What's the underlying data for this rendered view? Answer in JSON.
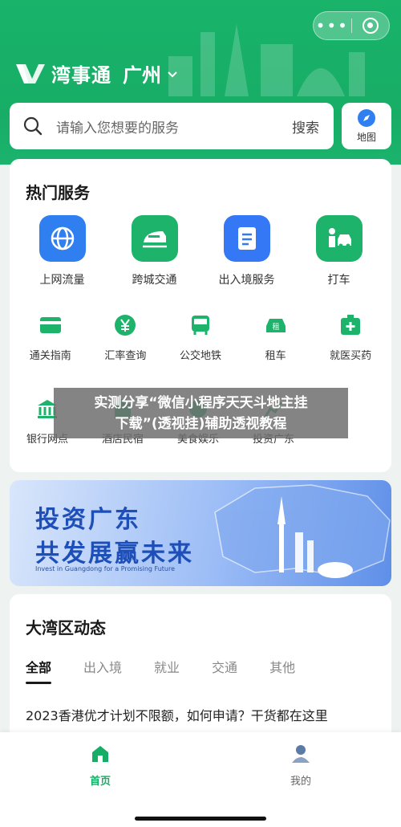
{
  "header": {
    "brand": "湾事通",
    "city": "广州",
    "capsule_menu_icon": "more-dots-icon",
    "capsule_close_icon": "target-icon"
  },
  "search": {
    "placeholder": "请输入您想要的服务",
    "button": "搜索",
    "map_label": "地图"
  },
  "hot_services": {
    "title": "热门服务",
    "primary": [
      {
        "label": "上网流量",
        "icon": "globe-icon"
      },
      {
        "label": "跨城交通",
        "icon": "train-icon"
      },
      {
        "label": "出入境服务",
        "icon": "document-plane-icon"
      },
      {
        "label": "打车",
        "icon": "taxi-icon"
      }
    ],
    "secondary": [
      {
        "label": "通关指南",
        "icon": "card-icon"
      },
      {
        "label": "汇率查询",
        "icon": "yen-icon"
      },
      {
        "label": "公交地铁",
        "icon": "bus-icon"
      },
      {
        "label": "租车",
        "icon": "rent-car-icon"
      },
      {
        "label": "就医买药",
        "icon": "medical-kit-icon"
      }
    ],
    "tertiary": [
      {
        "label": "银行网点",
        "icon": "bank-icon"
      },
      {
        "label": "酒店民宿",
        "icon": "hotel-icon"
      },
      {
        "label": "美食娱乐",
        "icon": "food-icon"
      },
      {
        "label": "投资广东",
        "icon": "invest-icon"
      }
    ]
  },
  "overlay": {
    "line1": "实测分享“微信小程序天天斗地主挂",
    "line2": "下载”(透视挂)辅助透视教程"
  },
  "banner": {
    "line1": "投资广东",
    "line2": "共发展赢未来",
    "subtitle": "Invest in Guangdong for a Promising Future"
  },
  "news": {
    "title": "大湾区动态",
    "tabs": [
      "全部",
      "出入境",
      "就业",
      "交通",
      "其他"
    ],
    "active_tab": "全部",
    "article": "2023香港优才计划不限额，如何申请？干货都在这里"
  },
  "tabbar": {
    "items": [
      {
        "label": "首页",
        "icon": "home-icon",
        "active": true
      },
      {
        "label": "我的",
        "icon": "user-icon",
        "active": false
      }
    ]
  },
  "colors": {
    "brand_green": "#17ad66",
    "icon_blue": "#2f7ff0",
    "banner_blue": "#1e4fb8"
  }
}
